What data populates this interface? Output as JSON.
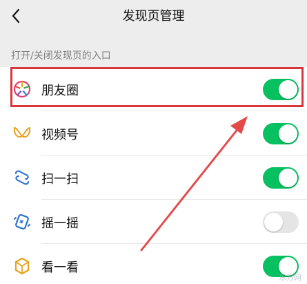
{
  "header": {
    "title": "发现页管理",
    "back_icon": "chevron-left-icon"
  },
  "section_label": "打开/关闭发现页的入口",
  "items": [
    {
      "label": "朋友圈",
      "icon": "moments-icon",
      "enabled": true
    },
    {
      "label": "视频号",
      "icon": "channels-icon",
      "enabled": true
    },
    {
      "label": "扫一扫",
      "icon": "scan-icon",
      "enabled": true
    },
    {
      "label": "摇一摇",
      "icon": "shake-icon",
      "enabled": false
    },
    {
      "label": "看一看",
      "icon": "top-stories-icon",
      "enabled": true
    }
  ],
  "annotation": {
    "highlight_item": "朋友圈",
    "color": "#d9363e"
  },
  "colors": {
    "toggle_on": "#07c160",
    "toggle_off": "#e5e5e5",
    "background": "#ededed"
  }
}
